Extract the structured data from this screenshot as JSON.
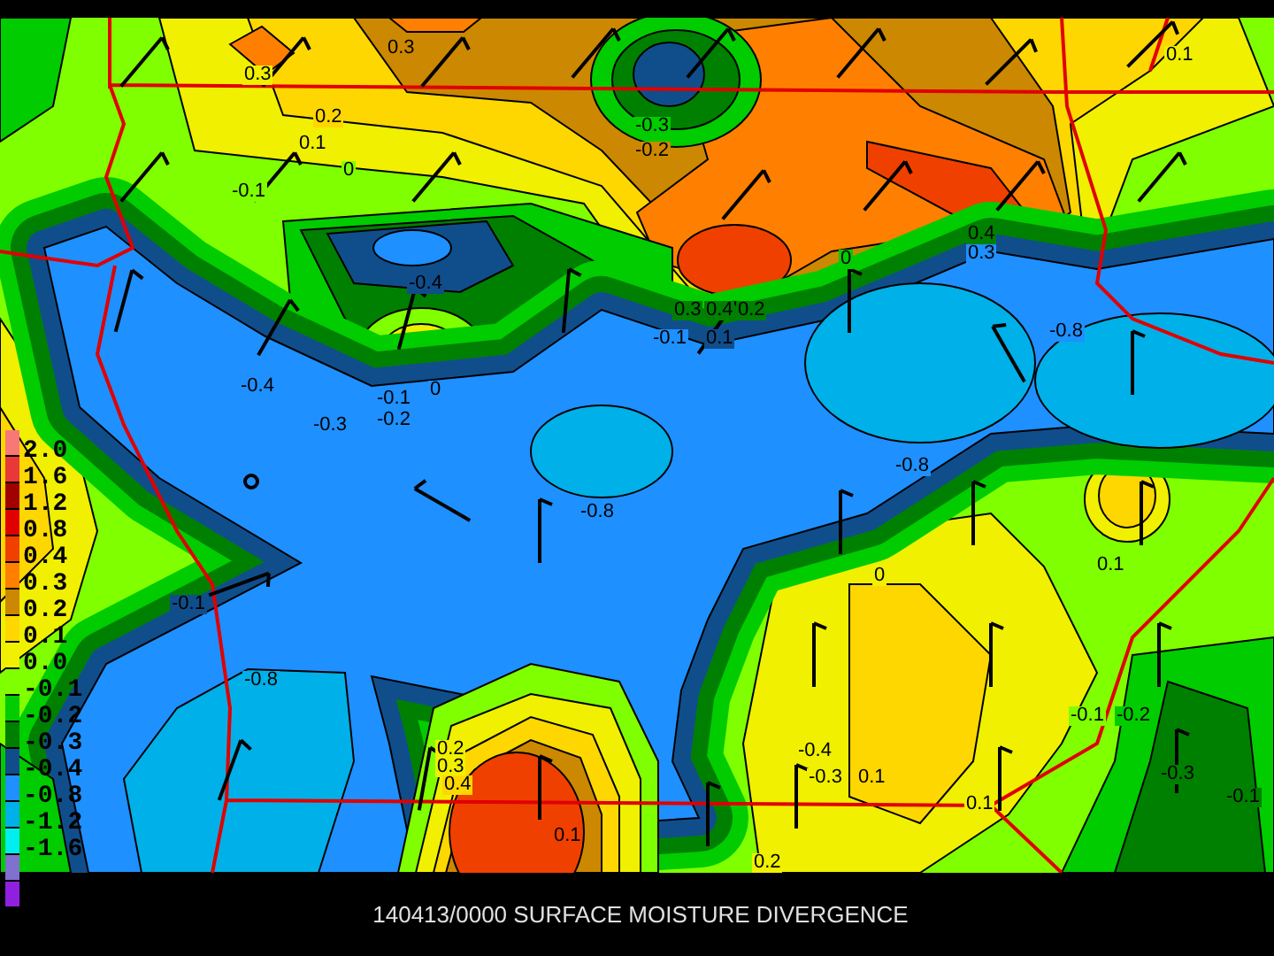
{
  "legend": {
    "swatches": [
      {
        "color": "#f87878"
      },
      {
        "color": "#e83838"
      },
      {
        "color": "#a00000"
      },
      {
        "color": "#e00000"
      },
      {
        "color": "#f04000"
      },
      {
        "color": "#ff8000"
      },
      {
        "color": "#cc8800"
      },
      {
        "color": "#ffd700"
      },
      {
        "color": "#f0f000"
      },
      {
        "color": "#80ff00"
      },
      {
        "color": "#00cc00"
      },
      {
        "color": "#008000"
      },
      {
        "color": "#104e8b"
      },
      {
        "color": "#1e90ff"
      },
      {
        "color": "#00b0e8"
      },
      {
        "color": "#00eeee"
      },
      {
        "color": "#8070d0"
      },
      {
        "color": "#9020e0"
      }
    ],
    "labels": [
      "2.0",
      "1.6",
      "1.2",
      "0.8",
      "0.4",
      "0.3",
      "0.2",
      "0.1",
      "0.0",
      "-0.1",
      "-0.2",
      "-0.3",
      "-0.4",
      "-0.8",
      "-1.2",
      "-1.6"
    ]
  },
  "contour_labels": [
    "0.3",
    "0.1",
    "0.3",
    "-0.3",
    "0.2",
    "0.1",
    "-0.2",
    "0",
    "-0.1",
    "0.4",
    "0.3",
    "0",
    "-0.4",
    "0.3",
    "0.4",
    "0.2",
    "-0.1",
    "0.1",
    "-0.8",
    "-0.4",
    "0",
    "-0.1",
    "-0.2",
    "-0.3",
    "-0.8",
    "-0.8",
    "-0.1",
    "0",
    "0.1",
    "-0.8",
    "-0.1",
    "-0.2",
    "0.2",
    "0.3",
    "0.4",
    "-0.4",
    "-0.3",
    "0.1",
    "-0.3",
    "0.1",
    "0.1",
    "-0.1",
    "0.2"
  ],
  "title": "140413/0000 SURFACE MOISTURE DIVERGENCE"
}
